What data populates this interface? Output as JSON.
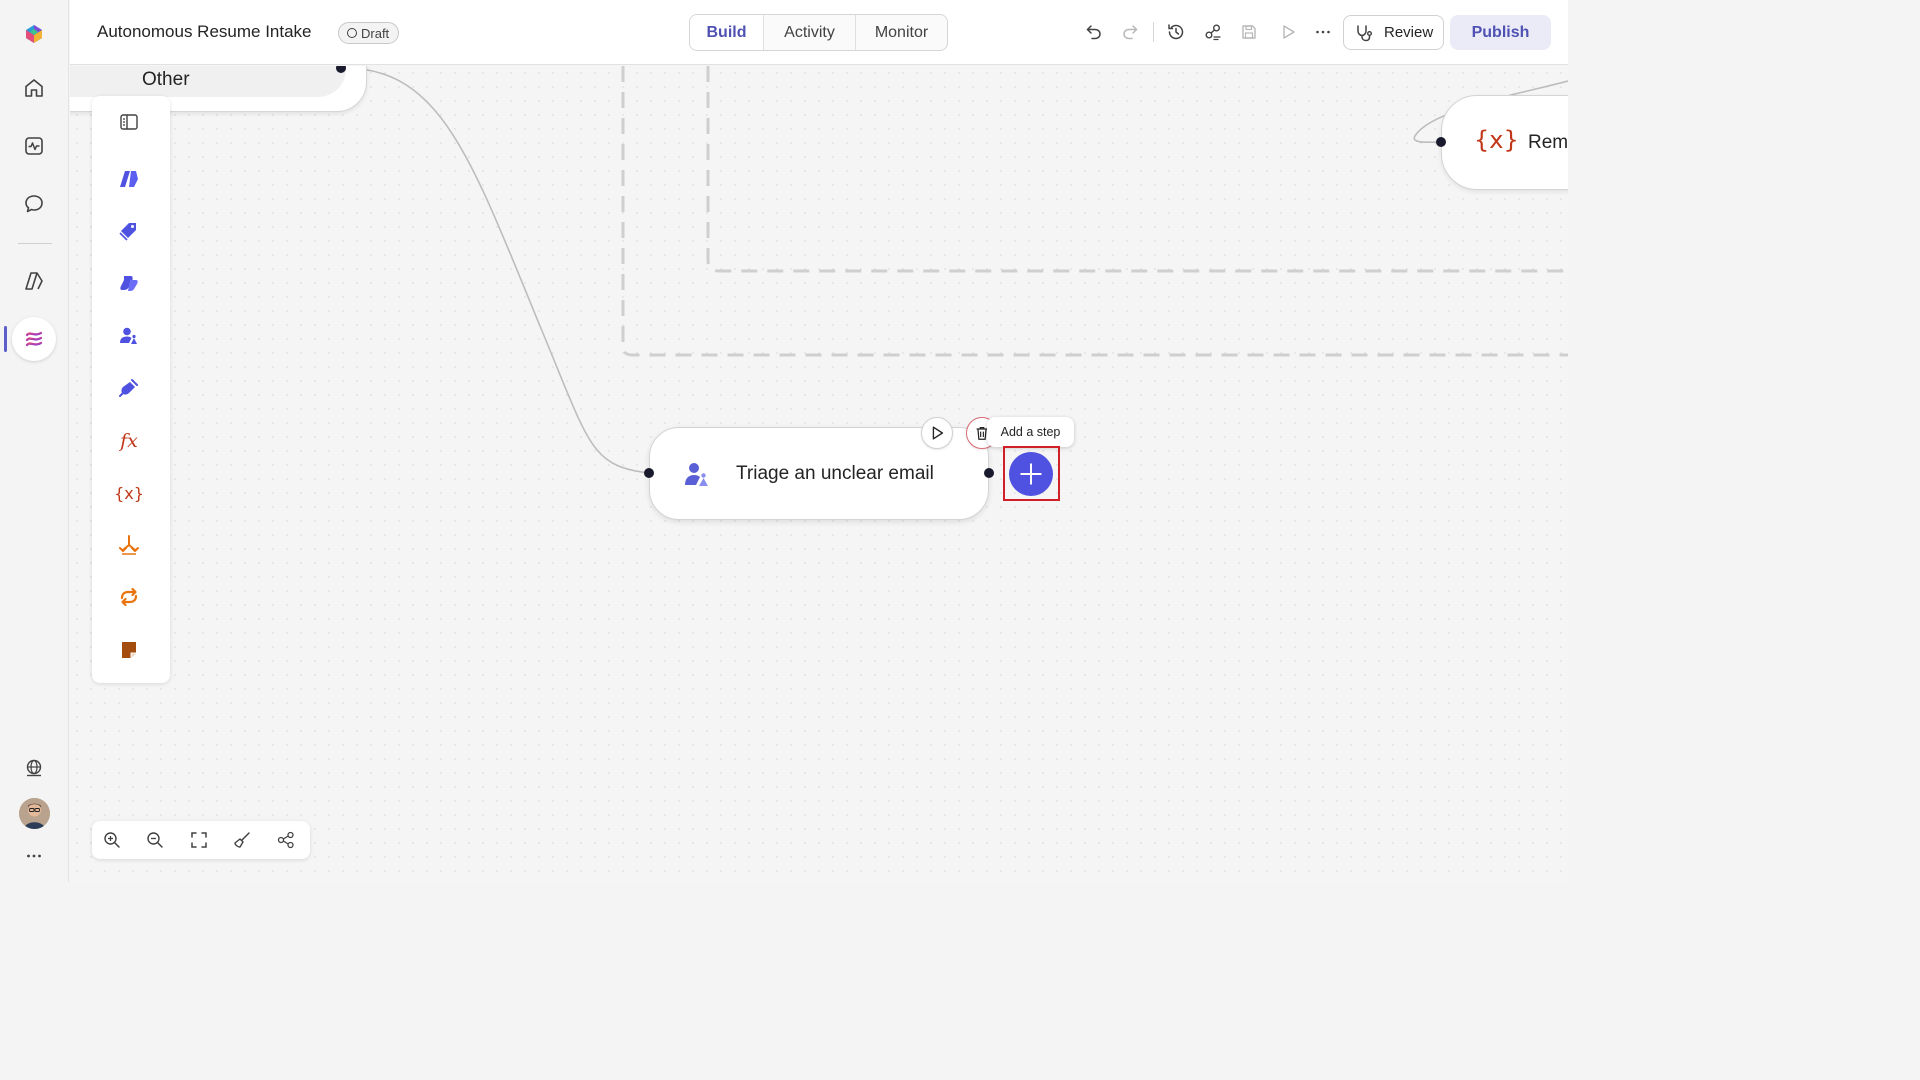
{
  "app": {
    "title": "Autonomous Resume Intake",
    "status_badge": "Draft"
  },
  "header": {
    "tabs": [
      {
        "label": "Build",
        "active": true
      },
      {
        "label": "Activity",
        "active": false
      },
      {
        "label": "Monitor",
        "active": false
      }
    ],
    "review_label": "Review",
    "publish_label": "Publish",
    "toolbar_icons": [
      "undo-icon",
      "redo-icon",
      "history-icon",
      "connections-icon",
      "save-icon",
      "run-icon",
      "more-icon"
    ]
  },
  "rail": {
    "items": [
      "home-icon",
      "activity-icon",
      "chat-icon",
      "power-automate-icon",
      "workflow-icon"
    ],
    "active": "workflow-icon",
    "bottom": [
      "globe-icon",
      "avatar",
      "more-icon"
    ]
  },
  "canvas": {
    "other_node": {
      "label": "Other"
    },
    "triage_node": {
      "label": "Triage an unclear email"
    },
    "add_step_tooltip": "Add a step",
    "rem_node": {
      "label": "Rem",
      "icon_text": "{x}"
    }
  },
  "toolbox": {
    "items": [
      "toggle-panel-icon",
      "automate-action-icon",
      "tag-icon",
      "copilot-action-icon",
      "human-review-icon",
      "connector-icon",
      "formula-icon",
      "variable-icon",
      "condition-icon",
      "loop-icon",
      "sticky-note-icon"
    ],
    "formula_text": "fx",
    "variable_text": "{x}"
  },
  "zoom_controls": [
    "zoom-in-icon",
    "zoom-out-icon",
    "fit-view-icon",
    "tidy-icon",
    "layout-icon"
  ],
  "colors": {
    "accent": "#4f52b2",
    "add_step": "#4f52e0",
    "highlight": "#d01f26",
    "variable": "#c1381a",
    "condition": "#e8730c"
  }
}
